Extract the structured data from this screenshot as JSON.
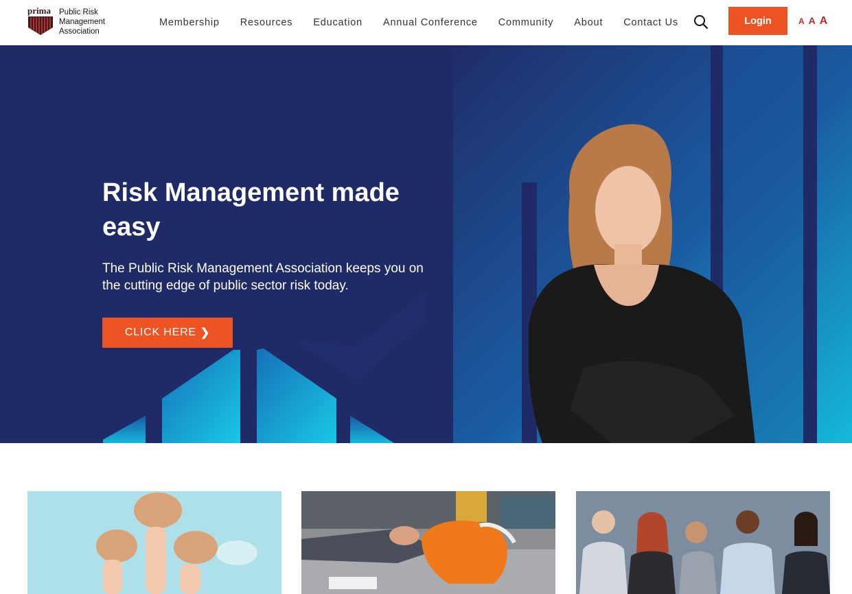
{
  "brand": {
    "logo_word": "prima",
    "name_lines": [
      "Public Risk",
      "Management",
      "Association"
    ]
  },
  "nav": {
    "items": [
      "Membership",
      "Resources",
      "Education",
      "Annual Conference",
      "Community",
      "About",
      "Contact Us"
    ]
  },
  "header": {
    "search_icon": "search-icon",
    "login_label": "Login",
    "font_size_controls": [
      "A",
      "A",
      "A"
    ]
  },
  "hero": {
    "title": "Risk Management made easy",
    "subtitle": "The Public Risk Management Association keeps you on the cutting edge of public sector risk today.",
    "cta_label": "CLICK HERE",
    "cta_icon": "chevron-right-icon"
  },
  "colors": {
    "accent": "#ee5423",
    "hero_navy": "#1f2b66",
    "hero_cyan": "#14b6dc",
    "font_control": "#c1272d"
  }
}
